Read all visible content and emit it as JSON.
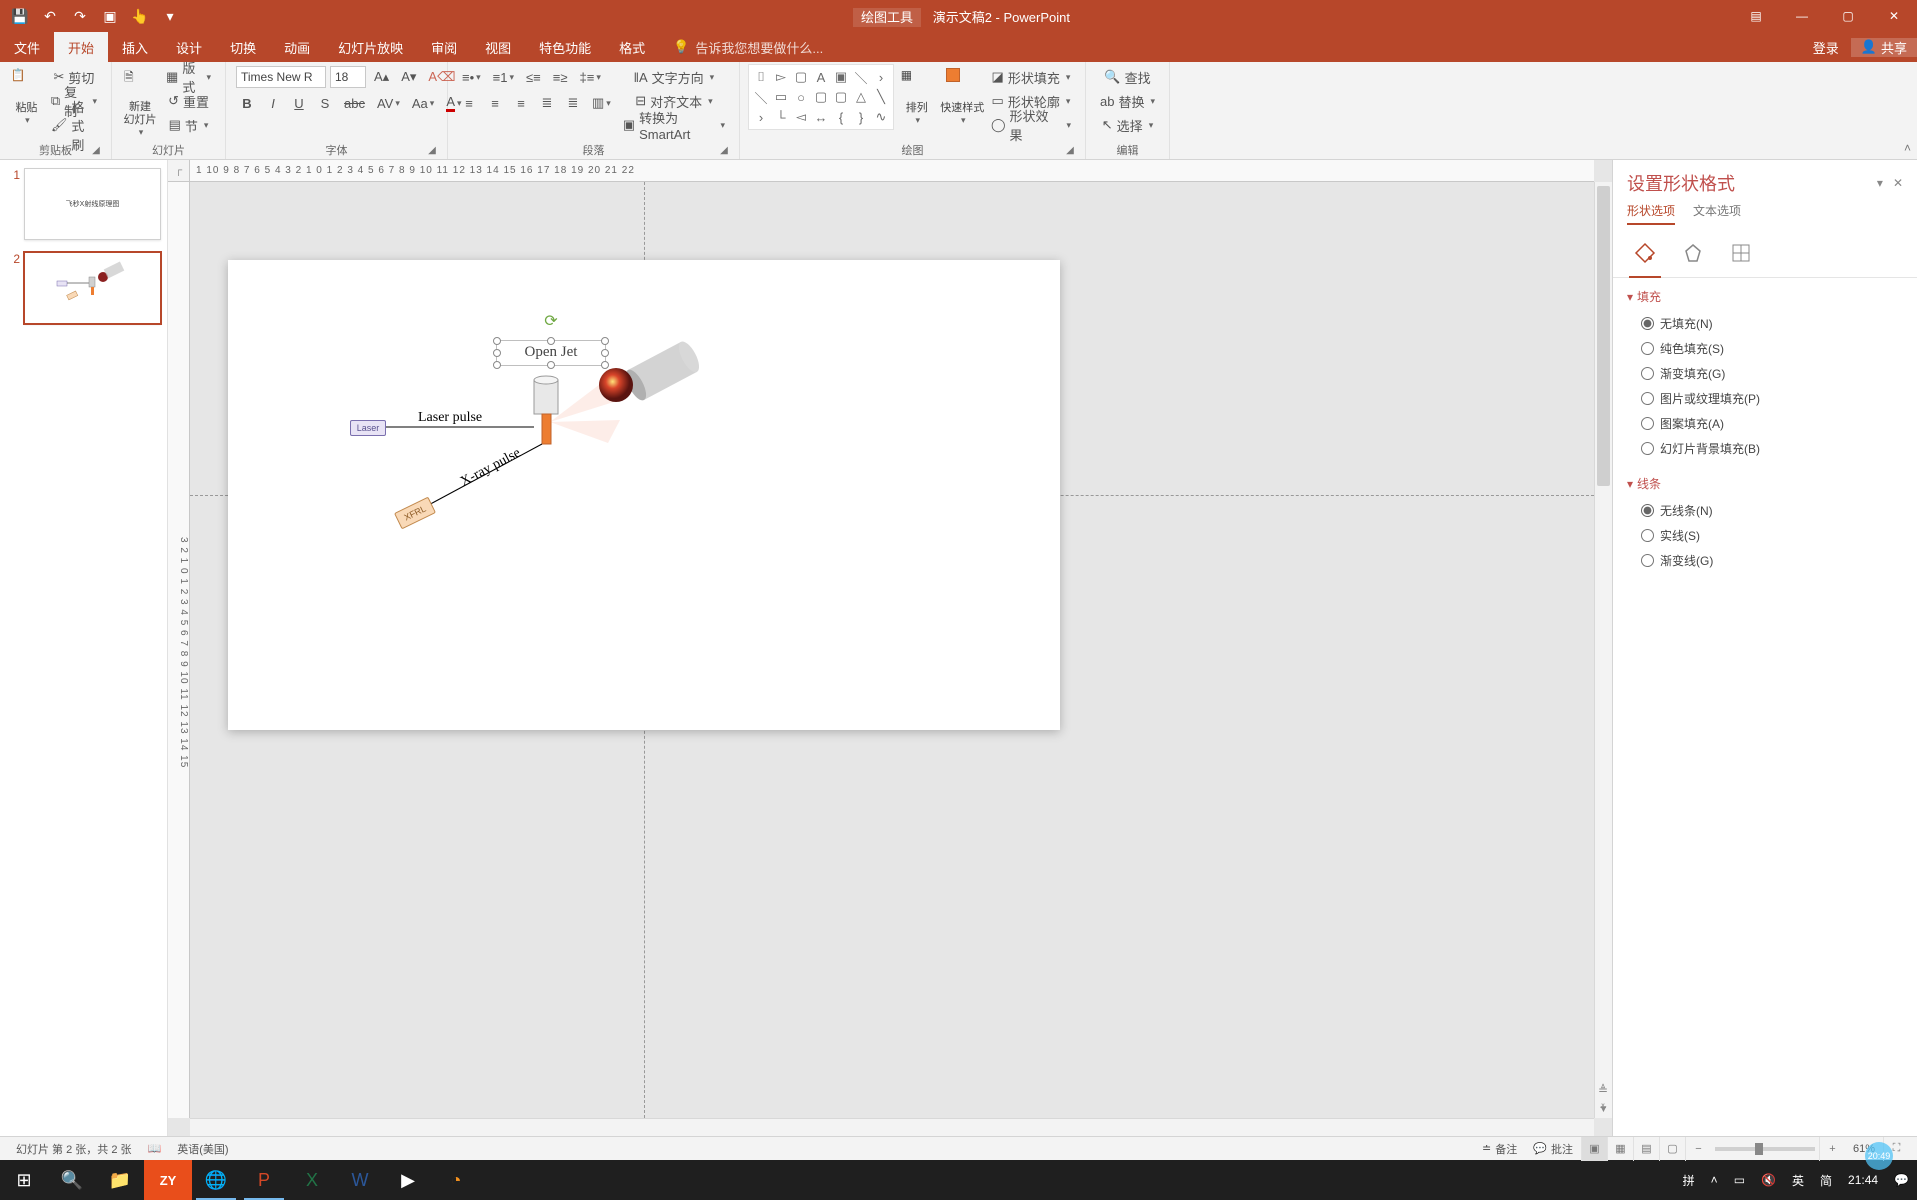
{
  "title_context": "绘图工具",
  "title_doc": "演示文稿2 - PowerPoint",
  "qat": {
    "save": "💾",
    "undo": "↶",
    "redo": "↷",
    "start": "▣",
    "touch": "👆",
    "more": "▾"
  },
  "window": {
    "ribbon_opts": "▤",
    "min": "—",
    "max": "▢",
    "close": "✕"
  },
  "tabs": {
    "file": "文件",
    "home": "开始",
    "insert": "插入",
    "design": "设计",
    "trans": "切换",
    "anim": "动画",
    "slideshow": "幻灯片放映",
    "review": "审阅",
    "view": "视图",
    "special": "特色功能",
    "format": "格式"
  },
  "tellme": {
    "icon": "💡",
    "text": "告诉我您想要做什么..."
  },
  "account": {
    "login": "登录",
    "share": "共享"
  },
  "ribbon": {
    "clipboard": {
      "label": "剪贴板",
      "paste": "粘贴",
      "cut": "剪切",
      "copy": "复制",
      "painter": "格式刷"
    },
    "slides": {
      "label": "幻灯片",
      "new": "新建\n幻灯片",
      "layout": "版式",
      "reset": "重置",
      "section": "节"
    },
    "font": {
      "label": "字体",
      "name": "Times New R",
      "size": "18"
    },
    "para": {
      "label": "段落",
      "textdir": "文字方向",
      "align": "对齐文本",
      "smart": "转换为 SmartArt"
    },
    "draw": {
      "label": "绘图",
      "arrange": "排列",
      "quick": "快速样式",
      "fill": "形状填充",
      "outline": "形状轮廓",
      "effects": "形状效果"
    },
    "editing": {
      "label": "编辑",
      "find": "查找",
      "replace": "替换",
      "select": "选择"
    }
  },
  "thumbs": [
    {
      "n": "1",
      "caption": "飞秒X射线原理图"
    },
    {
      "n": "2",
      "caption": ""
    }
  ],
  "ruler_h": "1  10  9   8   7   6   5   4   3   2   1   0   1   2   3   4   5   6   7   8   9   10  11  12  13  14  15  16  17  18  19  20  21  22",
  "ruler_v": "3  2  1  0  1  2  3  4  5  6  7  8  9  10  11  12  13  14  15",
  "slide": {
    "open_jet": "Open Jet",
    "laser_pulse": "Laser pulse",
    "laser": "Laser",
    "xray": "X-ray pulse",
    "xfrl": "XFRL"
  },
  "format_pane": {
    "title": "设置形状格式",
    "tab_shape": "形状选项",
    "tab_text": "文本选项",
    "fill": {
      "title": "填充",
      "none": "无填充(N)",
      "solid": "纯色填充(S)",
      "grad": "渐变填充(G)",
      "pic": "图片或纹理填充(P)",
      "patt": "图案填充(A)",
      "slidebg": "幻灯片背景填充(B)"
    },
    "line": {
      "title": "线条",
      "none": "无线条(N)",
      "solid": "实线(S)",
      "grad": "渐变线(G)"
    }
  },
  "status": {
    "slide_of": "幻灯片 第 2 张，共 2 张",
    "lang": "英语(美国)",
    "notes": "备注",
    "comments": "批注",
    "zoom": "61%"
  },
  "taskbar": {
    "ime1": "拼",
    "ime2": "英",
    "ime3": "简",
    "time": "21:44",
    "badge": "20:49"
  }
}
